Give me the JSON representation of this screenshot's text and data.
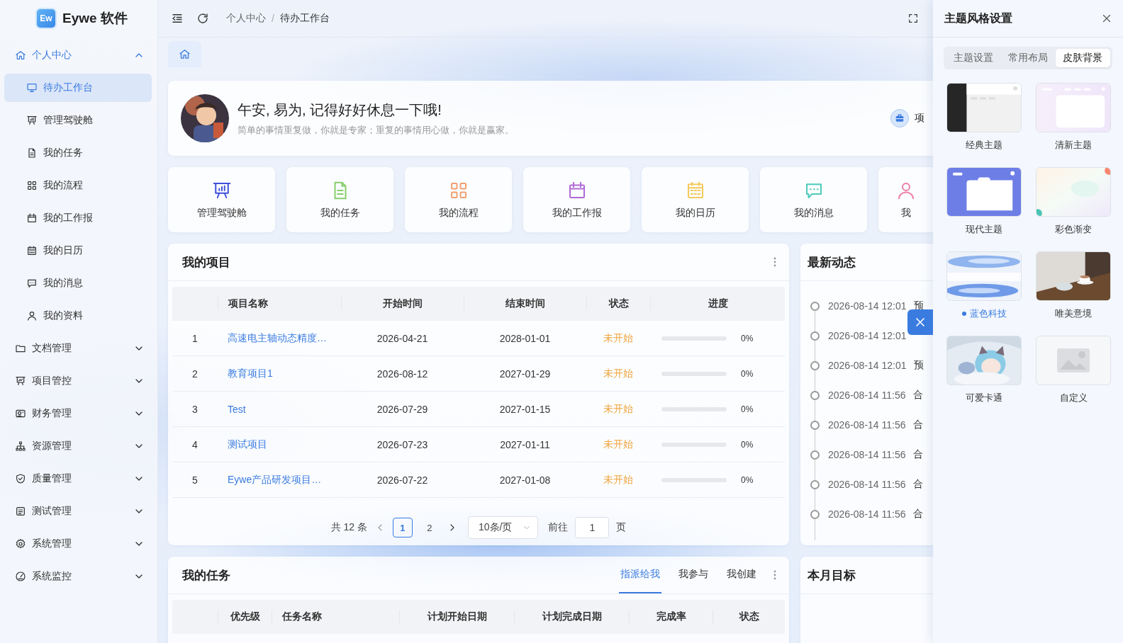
{
  "app": {
    "logo_text": "Ew",
    "name": "Eywe 软件"
  },
  "sidebar": {
    "items": [
      {
        "label": "个人中心",
        "selected": true,
        "expanded": true,
        "children": [
          {
            "label": "待办工作台",
            "selected": true
          },
          {
            "label": "管理驾驶舱",
            "selected": false
          },
          {
            "label": "我的任务",
            "selected": false
          },
          {
            "label": "我的流程",
            "selected": false
          },
          {
            "label": "我的工作报",
            "selected": false
          },
          {
            "label": "我的日历",
            "selected": false
          },
          {
            "label": "我的消息",
            "selected": false
          },
          {
            "label": "我的资料",
            "selected": false
          }
        ]
      },
      {
        "label": "文档管理",
        "selected": false,
        "expanded": false
      },
      {
        "label": "项目管控",
        "selected": false,
        "expanded": false
      },
      {
        "label": "财务管理",
        "selected": false,
        "expanded": false
      },
      {
        "label": "资源管理",
        "selected": false,
        "expanded": false
      },
      {
        "label": "质量管理",
        "selected": false,
        "expanded": false
      },
      {
        "label": "测试管理",
        "selected": false,
        "expanded": false
      },
      {
        "label": "系统管理",
        "selected": false,
        "expanded": false
      },
      {
        "label": "系统监控",
        "selected": false,
        "expanded": false
      }
    ]
  },
  "header": {
    "breadcrumb": [
      "个人中心",
      "待办工作台"
    ],
    "separator": "/"
  },
  "page_tabs": [
    {
      "selected": true
    }
  ],
  "banner": {
    "greeting": "午安, 易为, 记得好好休息一下哦!",
    "motto": "简单的事情重复做，你就是专家；重复的事情用心做，你就是赢家。",
    "side_label": "项"
  },
  "quick_links": [
    {
      "label": "管理驾驶舱",
      "color": "#3f51d9"
    },
    {
      "label": "我的任务",
      "color": "#86cf6a"
    },
    {
      "label": "我的流程",
      "color": "#f0a070"
    },
    {
      "label": "我的工作报",
      "color": "#b06ad6"
    },
    {
      "label": "我的日历",
      "color": "#f4c95c"
    },
    {
      "label": "我的消息",
      "color": "#4ccabb"
    },
    {
      "label": "我",
      "color": "#ef7fa3"
    }
  ],
  "projects": {
    "title": "我的项目",
    "columns": [
      "项目名称",
      "开始时间",
      "结束时间",
      "状态",
      "进度"
    ],
    "rows": [
      {
        "index": "1",
        "name": "高速电主轴动态精度…",
        "start": "2026-04-21",
        "end": "2028-01-01",
        "status": "未开始",
        "level": 0,
        "progress": "0%"
      },
      {
        "index": "2",
        "name": "教育项目1",
        "start": "2026-08-12",
        "end": "2027-01-29",
        "status": "未开始",
        "level": 0,
        "progress": "0%"
      },
      {
        "index": "3",
        "name": "Test",
        "start": "2026-07-29",
        "end": "2027-01-15",
        "status": "未开始",
        "level": 0,
        "progress": "0%"
      },
      {
        "index": "4",
        "name": "测试项目",
        "start": "2026-07-23",
        "end": "2027-01-11",
        "status": "未开始",
        "level": 0,
        "progress": "0%"
      },
      {
        "index": "5",
        "name": "Eywe产品研发项目…",
        "start": "2026-07-22",
        "end": "2027-01-08",
        "status": "未开始",
        "level": 0,
        "progress": "0%"
      }
    ],
    "pagination": {
      "total": "共 12 条",
      "pages": [
        {
          "label": "1",
          "selected": true
        },
        {
          "label": "2",
          "selected": false
        }
      ],
      "page_size": "10条/页",
      "goto_label": "前往",
      "goto_value": "1",
      "goto_suffix": "页"
    }
  },
  "activity": {
    "title": "最新动态",
    "items": [
      {
        "time": "2026-08-14 12:01",
        "text": "预"
      },
      {
        "time": "2026-08-14 12:01"
      },
      {
        "time": "2026-08-14 12:01",
        "text": "预"
      },
      {
        "time": "2026-08-14 11:56",
        "text": "合"
      },
      {
        "time": "2026-08-14 11:56",
        "text": "合"
      },
      {
        "time": "2026-08-14 11:56",
        "text": "合"
      },
      {
        "time": "2026-08-14 11:56",
        "text": "合"
      },
      {
        "time": "2026-08-14 11:56",
        "text": "合"
      }
    ]
  },
  "tasks": {
    "title": "我的任务",
    "tabs": [
      {
        "label": "指派给我",
        "selected": true
      },
      {
        "label": "我参与",
        "selected": false
      },
      {
        "label": "我创建",
        "selected": false
      }
    ],
    "columns": [
      "优先级",
      "任务名称",
      "计划开始日期",
      "计划完成日期",
      "完成率",
      "状态"
    ]
  },
  "goals": {
    "title": "本月目标"
  },
  "theme_drawer": {
    "title": "主题风格设置",
    "tabs": [
      {
        "label": "主题设置",
        "selected": false
      },
      {
        "label": "常用布局",
        "selected": false
      },
      {
        "label": "皮肤背景",
        "selected": true
      }
    ],
    "themes": [
      {
        "label": "经典主题",
        "kind": "classic",
        "selected": false
      },
      {
        "label": "清新主题",
        "kind": "fresh",
        "selected": false
      },
      {
        "label": "现代主题",
        "kind": "modern",
        "selected": false
      },
      {
        "label": "彩色渐变",
        "kind": "gradient",
        "selected": false
      },
      {
        "label": "蓝色科技",
        "kind": "picture",
        "selected": true
      },
      {
        "label": "唯美意境",
        "kind": "picture",
        "selected": false
      },
      {
        "label": "可爱卡通",
        "kind": "picture",
        "selected": false
      },
      {
        "label": "自定义",
        "kind": "custom",
        "selected": false
      }
    ]
  }
}
